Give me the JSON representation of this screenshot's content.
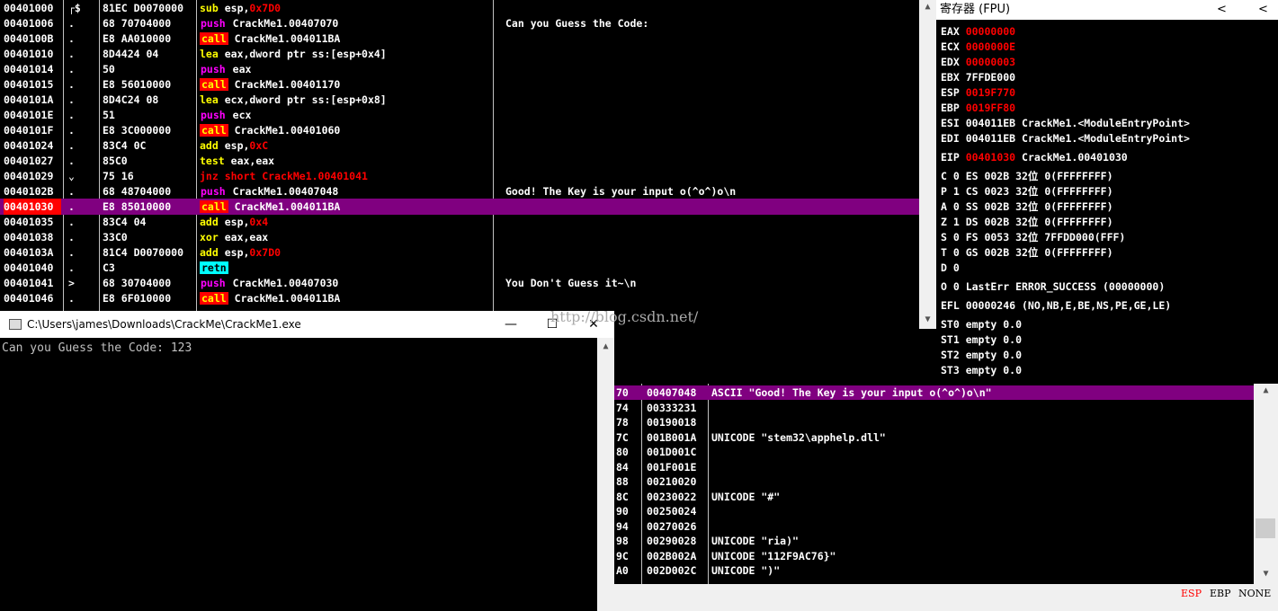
{
  "disasm": {
    "rows": [
      {
        "addr": "00401000",
        "mark": "┌$",
        "bytes": "81EC D0070000",
        "mnem": "sub",
        "args": "esp,",
        "num": "0x7D0",
        "kind": "mnem",
        "comment": ""
      },
      {
        "addr": "00401006",
        "mark": ".",
        "bytes": "68 70704000",
        "mnem": "push",
        "args": "CrackMe1.00407070",
        "num": "",
        "kind": "push",
        "comment": "Can you Guess the Code:"
      },
      {
        "addr": "0040100B",
        "mark": ".",
        "bytes": "E8 AA010000",
        "mnem": "call",
        "args": "CrackMe1.004011BA",
        "num": "",
        "kind": "call",
        "comment": ""
      },
      {
        "addr": "00401010",
        "mark": ".",
        "bytes": "8D4424 04",
        "mnem": "lea",
        "args": "eax,dword ptr ss:[esp+0x4]",
        "num": "",
        "kind": "mnem",
        "comment": ""
      },
      {
        "addr": "00401014",
        "mark": ".",
        "bytes": "50",
        "mnem": "push",
        "args": "eax",
        "num": "",
        "kind": "push",
        "comment": ""
      },
      {
        "addr": "00401015",
        "mark": ".",
        "bytes": "E8 56010000",
        "mnem": "call",
        "args": "CrackMe1.00401170",
        "num": "",
        "kind": "call",
        "comment": ""
      },
      {
        "addr": "0040101A",
        "mark": ".",
        "bytes": "8D4C24 08",
        "mnem": "lea",
        "args": "ecx,dword ptr ss:[esp+0x8]",
        "num": "",
        "kind": "mnem",
        "comment": ""
      },
      {
        "addr": "0040101E",
        "mark": ".",
        "bytes": "51",
        "mnem": "push",
        "args": "ecx",
        "num": "",
        "kind": "push",
        "comment": ""
      },
      {
        "addr": "0040101F",
        "mark": ".",
        "bytes": "E8 3C000000",
        "mnem": "call",
        "args": "CrackMe1.00401060",
        "num": "",
        "kind": "call",
        "comment": ""
      },
      {
        "addr": "00401024",
        "mark": ".",
        "bytes": "83C4 0C",
        "mnem": "add",
        "args": "esp,",
        "num": "0xC",
        "kind": "mnem",
        "comment": ""
      },
      {
        "addr": "00401027",
        "mark": ".",
        "bytes": "85C0",
        "mnem": "test",
        "args": "eax,eax",
        "num": "",
        "kind": "mnem",
        "comment": ""
      },
      {
        "addr": "00401029",
        "mark": "⌄",
        "bytes": "75 16",
        "mnem": "jnz short",
        "args": "CrackMe1.00401041",
        "num": "",
        "kind": "jmp",
        "comment": ""
      },
      {
        "addr": "0040102B",
        "mark": ".",
        "bytes": "68 48704000",
        "mnem": "push",
        "args": "CrackMe1.00407048",
        "num": "",
        "kind": "push",
        "comment": "Good! The Key is your input o(^o^)o\\n"
      },
      {
        "addr": "00401030",
        "mark": ".",
        "bytes": "E8 85010000",
        "mnem": "call",
        "args": "CrackMe1.004011BA",
        "num": "",
        "kind": "call",
        "comment": "",
        "selected": true
      },
      {
        "addr": "00401035",
        "mark": ".",
        "bytes": "83C4 04",
        "mnem": "add",
        "args": "esp,",
        "num": "0x4",
        "kind": "mnem",
        "comment": ""
      },
      {
        "addr": "00401038",
        "mark": ".",
        "bytes": "33C0",
        "mnem": "xor",
        "args": "eax,eax",
        "num": "",
        "kind": "mnem",
        "comment": ""
      },
      {
        "addr": "0040103A",
        "mark": ".",
        "bytes": "81C4 D0070000",
        "mnem": "add",
        "args": "esp,",
        "num": "0x7D0",
        "kind": "mnem",
        "comment": ""
      },
      {
        "addr": "00401040",
        "mark": ".",
        "bytes": "C3",
        "mnem": "retn",
        "args": "",
        "num": "",
        "kind": "ret",
        "comment": ""
      },
      {
        "addr": "00401041",
        "mark": ">",
        "bytes": "68 30704000",
        "mnem": "push",
        "args": "CrackMe1.00407030",
        "num": "",
        "kind": "push",
        "comment": "You Don't Guess it~\\n"
      },
      {
        "addr": "00401046",
        "mark": ".",
        "bytes": "E8 6F010000",
        "mnem": "call",
        "args": "CrackMe1.004011BA",
        "num": "",
        "kind": "call",
        "comment": ""
      }
    ]
  },
  "registers": {
    "title": "寄存器 (FPU)",
    "nav_prev": "<",
    "nav_next": "<",
    "lines": [
      {
        "text": "EAX ",
        "val": "00000000",
        "red": true
      },
      {
        "text": "ECX ",
        "val": "0000000E",
        "red": true
      },
      {
        "text": "EDX ",
        "val": "00000003",
        "red": true
      },
      {
        "text": "EBX 7FFDE000",
        "val": "",
        "red": false
      },
      {
        "text": "ESP ",
        "val": "0019F770",
        "red": true
      },
      {
        "text": "EBP ",
        "val": "0019FF80",
        "red": true
      },
      {
        "text": "ESI 004011EB CrackMe1.<ModuleEntryPoint>",
        "val": "",
        "red": false
      },
      {
        "text": "EDI 004011EB CrackMe1.<ModuleEntryPoint>",
        "val": "",
        "red": false
      },
      {
        "text": "EIP ",
        "val": "00401030",
        "red": true,
        "after": " CrackMe1.00401030",
        "gap": true
      },
      {
        "text": "C 0  ES 002B 32位 0(FFFFFFFF)",
        "val": "",
        "red": false,
        "gap": true
      },
      {
        "text": "P 1  CS 0023 32位 0(FFFFFFFF)",
        "val": "",
        "red": false
      },
      {
        "text": "A 0  SS 002B 32位 0(FFFFFFFF)",
        "val": "",
        "red": false
      },
      {
        "text": "Z 1  DS 002B 32位 0(FFFFFFFF)",
        "val": "",
        "red": false
      },
      {
        "text": "S 0  FS 0053 32位 7FFDD000(FFF)",
        "val": "",
        "red": false
      },
      {
        "text": "T 0  GS 002B 32位 0(FFFFFFFF)",
        "val": "",
        "red": false
      },
      {
        "text": "D 0",
        "val": "",
        "red": false
      },
      {
        "text": "O 0  LastErr ERROR_SUCCESS (00000000)",
        "val": "",
        "red": false,
        "gap": true
      },
      {
        "text": "EFL 00000246 (NO,NB,E,BE,NS,PE,GE,LE)",
        "val": "",
        "red": false,
        "gap": true
      },
      {
        "text": "ST0 empty 0.0",
        "val": "",
        "red": false,
        "gap": true
      },
      {
        "text": "ST1 empty 0.0",
        "val": "",
        "red": false
      },
      {
        "text": "ST2 empty 0.0",
        "val": "",
        "red": false
      },
      {
        "text": "ST3 empty 0.0",
        "val": "",
        "red": false
      }
    ]
  },
  "console": {
    "title": "C:\\Users\\james\\Downloads\\CrackMe\\CrackMe1.exe",
    "minimize": "—",
    "maximize": "☐",
    "close": "✕",
    "output": "Can you Guess the Code: 123"
  },
  "watermark": "http://blog.csdn.net/",
  "dump": {
    "rows": [
      {
        "a": "70",
        "v": "00407048",
        "c": "ASCII \"Good! The Key is your input o(^o^)o\\n\"",
        "selected": true
      },
      {
        "a": "74",
        "v": "00333231",
        "c": ""
      },
      {
        "a": "78",
        "v": "00190018",
        "c": ""
      },
      {
        "a": "7C",
        "v": "001B001A",
        "c": "UNICODE \"stem32\\apphelp.dll\""
      },
      {
        "a": "80",
        "v": "001D001C",
        "c": ""
      },
      {
        "a": "84",
        "v": "001F001E",
        "c": ""
      },
      {
        "a": "88",
        "v": "00210020",
        "c": ""
      },
      {
        "a": "8C",
        "v": "00230022",
        "c": "UNICODE \"#\""
      },
      {
        "a": "90",
        "v": "00250024",
        "c": ""
      },
      {
        "a": "94",
        "v": "00270026",
        "c": ""
      },
      {
        "a": "98",
        "v": "00290028",
        "c": "UNICODE \"ria)\""
      },
      {
        "a": "9C",
        "v": "002B002A",
        "c": "UNICODE \"112F9AC76}\""
      },
      {
        "a": "A0",
        "v": "002D002C",
        "c": "UNICODE \")\""
      }
    ]
  },
  "status": {
    "esp": "ESP",
    "ebp": "EBP",
    "none": "NONE"
  },
  "colors": {
    "selection": "#800080",
    "red": "#ff0000",
    "mnem": "#ffff00",
    "push": "#ff00ff",
    "ret": "#00ffff"
  }
}
